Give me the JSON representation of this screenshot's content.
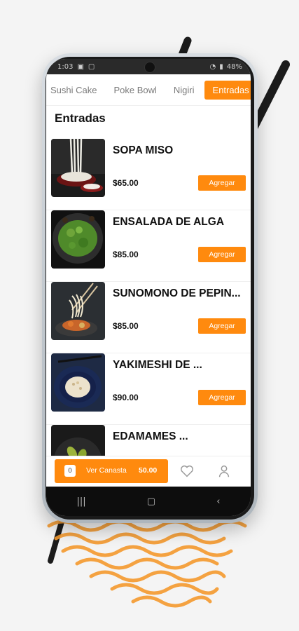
{
  "status_bar": {
    "time": "1:03",
    "battery": "48%"
  },
  "tabs": [
    {
      "label": "Sushi Cake",
      "active": false
    },
    {
      "label": "Poke Bowl",
      "active": false
    },
    {
      "label": "Nigiri",
      "active": false
    },
    {
      "label": "Entradas",
      "active": true
    }
  ],
  "section_title": "Entradas",
  "items": [
    {
      "name": "SOPA MISO",
      "price": "$65.00",
      "button": "Agregar",
      "image": "noodle-soup-bowl"
    },
    {
      "name": "ENSALADA DE ALGA",
      "price": "$85.00",
      "button": "Agregar",
      "image": "seaweed-salad"
    },
    {
      "name": "SUNOMONO DE PEPIN...",
      "price": "$85.00",
      "button": "Agregar",
      "image": "sunomono-chopsticks"
    },
    {
      "name": "YAKIMESHI DE ...",
      "price": "$90.00",
      "button": "Agregar",
      "image": "fried-rice-bowl"
    },
    {
      "name": "EDAMAMES ...",
      "price": "",
      "button": "",
      "image": "edamame-bowl"
    }
  ],
  "cart": {
    "count": "0",
    "label": "Ver Canasta",
    "total": "50.00"
  },
  "colors": {
    "accent": "#ff8a0e",
    "text": "#111111",
    "muted": "#7a7a7a"
  },
  "icons": {
    "favorites": "heart-icon",
    "profile": "user-icon",
    "recents": "recents-icon",
    "home": "home-icon",
    "back": "back-icon"
  }
}
